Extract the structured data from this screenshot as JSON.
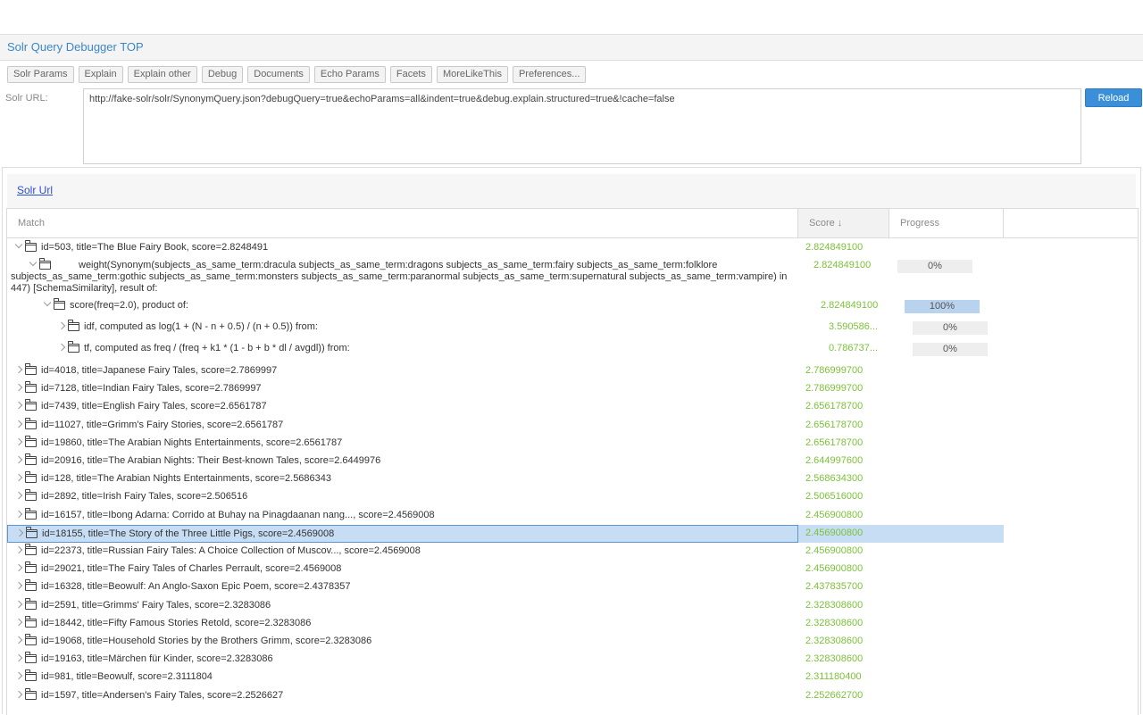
{
  "header": {
    "title": "Solr Query Debugger TOP"
  },
  "toolbar": {
    "buttons": [
      "Solr Params",
      "Explain",
      "Explain other",
      "Debug",
      "Documents",
      "Echo Params",
      "Facets",
      "MoreLikeThis",
      "Preferences..."
    ]
  },
  "url_section": {
    "label": "Solr URL:",
    "value": "http://fake-solr/solr/SynonymQuery.json?debugQuery=true&echoParams=all&indent=true&debug.explain.structured=true&!cache=false",
    "reload_label": "Reload"
  },
  "panel": {
    "link": "Solr Url"
  },
  "grid": {
    "columns": {
      "match": "Match",
      "score": "Score ↓",
      "progress": "Progress"
    },
    "detail_rows": [
      {
        "label": "id=503, title=The Blue Fairy Book, score=2.8248491",
        "score": "2.824849100"
      },
      {
        "label": "weight(Synonym(subjects_as_same_term:dracula subjects_as_same_term:dragons subjects_as_same_term:fairy subjects_as_same_term:folklore subjects_as_same_term:gothic subjects_as_same_term:monsters subjects_as_same_term:paranormal subjects_as_same_term:supernatural subjects_as_same_term:vampire) in 447) [SchemaSimilarity], result of:",
        "score": "2.824849100",
        "progress": 0,
        "progress_label": "0%"
      },
      {
        "label": "score(freq=2.0), product of:",
        "score": "2.824849100",
        "progress": 100,
        "progress_label": "100%"
      },
      {
        "label": "idf, computed as log(1 + (N - n + 0.5) / (n + 0.5)) from:",
        "score": "3.590586...",
        "progress": 0,
        "progress_label": "0%"
      },
      {
        "label": "tf, computed as freq / (freq + k1 * (1 - b + b * dl / avgdl)) from:",
        "score": "0.786737...",
        "progress": 0,
        "progress_label": "0%"
      }
    ],
    "rows": [
      {
        "label": "id=4018, title=Japanese Fairy Tales, score=2.7869997",
        "score": "2.786999700"
      },
      {
        "label": "id=7128, title=Indian Fairy Tales, score=2.7869997",
        "score": "2.786999700"
      },
      {
        "label": "id=7439, title=English Fairy Tales, score=2.6561787",
        "score": "2.656178700"
      },
      {
        "label": "id=11027, title=Grimm's Fairy Stories, score=2.6561787",
        "score": "2.656178700"
      },
      {
        "label": "id=19860, title=The Arabian Nights Entertainments, score=2.6561787",
        "score": "2.656178700"
      },
      {
        "label": "id=20916, title=The Arabian Nights: Their Best-known Tales, score=2.6449976",
        "score": "2.644997600"
      },
      {
        "label": "id=128, title=The Arabian Nights Entertainments, score=2.5686343",
        "score": "2.568634300"
      },
      {
        "label": "id=2892, title=Irish Fairy Tales, score=2.506516",
        "score": "2.506516000"
      },
      {
        "label": "id=16157, title=Ibong Adarna: Corrido at Buhay na Pinagdaanan nang..., score=2.4569008",
        "score": "2.456900800"
      },
      {
        "label": "id=18155, title=The Story of the Three Little Pigs, score=2.4569008",
        "score": "2.456900800",
        "selected": true
      },
      {
        "label": "id=22373, title=Russian Fairy Tales: A Choice Collection of Muscov..., score=2.4569008",
        "score": "2.456900800"
      },
      {
        "label": "id=29021, title=The Fairy Tales of Charles Perrault, score=2.4569008",
        "score": "2.456900800"
      },
      {
        "label": "id=16328, title=Beowulf: An Anglo-Saxon Epic Poem, score=2.4378357",
        "score": "2.437835700"
      },
      {
        "label": "id=2591, title=Grimms' Fairy Tales, score=2.3283086",
        "score": "2.328308600"
      },
      {
        "label": "id=18442, title=Fifty Famous Stories Retold, score=2.3283086",
        "score": "2.328308600"
      },
      {
        "label": "id=19068, title=Household Stories by the Brothers Grimm, score=2.3283086",
        "score": "2.328308600"
      },
      {
        "label": "id=19163, title=Märchen für Kinder, score=2.3283086",
        "score": "2.328308600"
      },
      {
        "label": "id=981, title=Beowulf, score=2.3111804",
        "score": "2.311180400"
      },
      {
        "label": "id=1597, title=Andersen's Fairy Tales, score=2.2526627",
        "score": "2.252662700"
      }
    ]
  }
}
